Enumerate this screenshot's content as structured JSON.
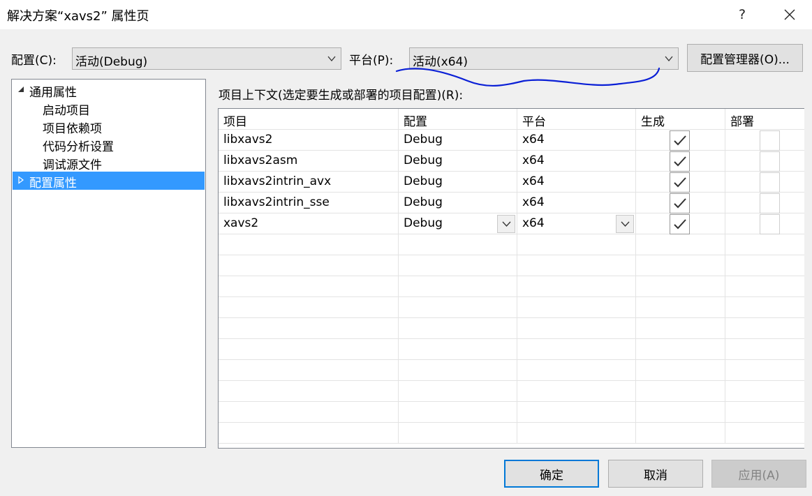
{
  "window": {
    "title": "解决方案“xavs2” 属性页",
    "help_symbol": "?"
  },
  "toolbar": {
    "config_label": "配置(C):",
    "config_value": "活动(Debug)",
    "platform_label": "平台(P):",
    "platform_value": "活动(x64)",
    "config_manager_label": "配置管理器(O)..."
  },
  "tree": {
    "items": [
      {
        "label": "通用属性",
        "expanded": true
      },
      {
        "label": "启动项目"
      },
      {
        "label": "项目依赖项"
      },
      {
        "label": "代码分析设置"
      },
      {
        "label": "调试源文件"
      },
      {
        "label": "配置属性",
        "expanded": false,
        "selected": true
      }
    ]
  },
  "grid": {
    "caption": "项目上下文(选定要生成或部署的项目配置)(R):",
    "columns": [
      "项目",
      "配置",
      "平台",
      "生成",
      "部署"
    ],
    "rows": [
      {
        "project": "libxavs2",
        "config": "Debug",
        "platform": "x64",
        "build": true,
        "deploy": false
      },
      {
        "project": "libxavs2asm",
        "config": "Debug",
        "platform": "x64",
        "build": true,
        "deploy": false
      },
      {
        "project": "libxavs2intrin_avx",
        "config": "Debug",
        "platform": "x64",
        "build": true,
        "deploy": false
      },
      {
        "project": "libxavs2intrin_sse",
        "config": "Debug",
        "platform": "x64",
        "build": true,
        "deploy": false
      },
      {
        "project": "xavs2",
        "config": "Debug",
        "platform": "x64",
        "build": true,
        "deploy": false
      }
    ]
  },
  "buttons": {
    "ok": "确定",
    "cancel": "取消",
    "apply": "应用(A)"
  },
  "colors": {
    "selection": "#3399ff",
    "primary_border": "#0078d7",
    "annotation_ink": "#0a1fd6"
  }
}
